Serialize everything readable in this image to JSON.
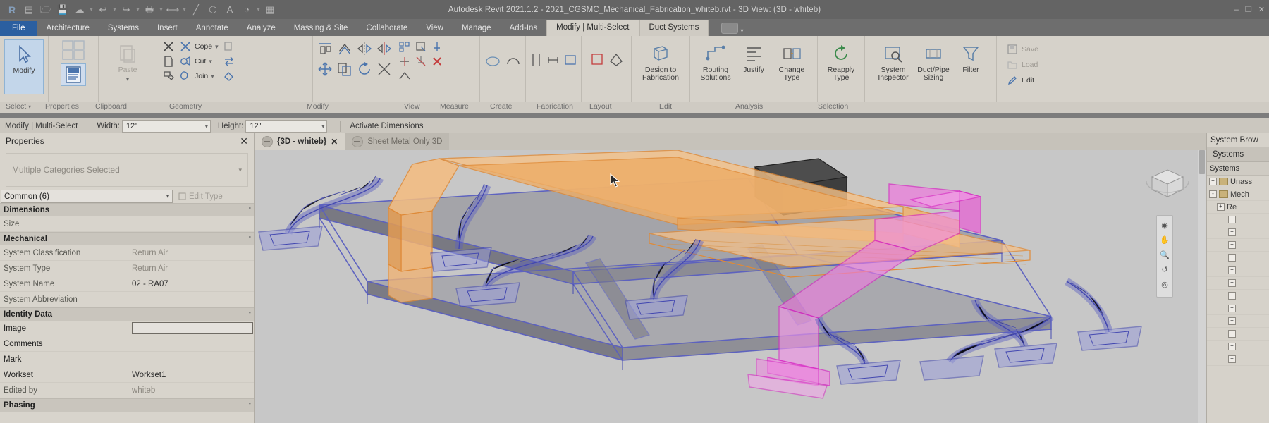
{
  "window": {
    "title": "Autodesk Revit 2021.1.2 - 2021_CGSMC_Mechanical_Fabrication_whiteb.rvt - 3D View: (3D - whiteb)",
    "minimize": "–",
    "maximize": "❐",
    "close": "✕"
  },
  "quick_access": [
    {
      "name": "revit-logo-icon",
      "glyph": "R"
    },
    {
      "name": "new-project-icon",
      "glyph": "▤"
    },
    {
      "name": "open-file-icon",
      "glyph": "🗁"
    },
    {
      "name": "save-icon",
      "glyph": "💾"
    },
    {
      "name": "sync-with-central-icon",
      "glyph": "☁"
    },
    {
      "name": "undo-icon",
      "glyph": "↩"
    },
    {
      "name": "redo-icon",
      "glyph": "↪"
    },
    {
      "name": "print-icon",
      "glyph": "🖨"
    },
    {
      "name": "measure-icon",
      "glyph": "⟷"
    },
    {
      "name": "aligned-dimension-icon",
      "glyph": "╱"
    },
    {
      "name": "tag-icon",
      "glyph": "⬡"
    },
    {
      "name": "text-icon",
      "glyph": "A"
    },
    {
      "name": "section-icon",
      "glyph": "◔"
    },
    {
      "name": "thin-lines-icon",
      "glyph": "▦"
    }
  ],
  "ribbon_tabs": [
    {
      "label": "File",
      "state": "file"
    },
    {
      "label": "Architecture",
      "state": "normal"
    },
    {
      "label": "Systems",
      "state": "normal"
    },
    {
      "label": "Insert",
      "state": "normal"
    },
    {
      "label": "Annotate",
      "state": "normal"
    },
    {
      "label": "Analyze",
      "state": "normal"
    },
    {
      "label": "Massing & Site",
      "state": "normal"
    },
    {
      "label": "Collaborate",
      "state": "normal"
    },
    {
      "label": "View",
      "state": "normal"
    },
    {
      "label": "Manage",
      "state": "normal"
    },
    {
      "label": "Add-Ins",
      "state": "normal"
    },
    {
      "label": "Modify | Multi-Select",
      "state": "active"
    },
    {
      "label": "Duct Systems",
      "state": "context"
    }
  ],
  "ribbon": {
    "select": {
      "panel_label": "Select",
      "modify_label": "Modify"
    },
    "properties": {
      "panel_label": "Properties",
      "properties_label": "Properties"
    },
    "clipboard": {
      "panel_label": "Clipboard",
      "paste_label": "Paste"
    },
    "geometry": {
      "panel_label": "Geometry",
      "cope_label": "Cope",
      "cut_label": "Cut",
      "join_label": "Join"
    },
    "modify": {
      "panel_label": "Modify"
    },
    "view": {
      "panel_label": "View"
    },
    "measure": {
      "panel_label": "Measure"
    },
    "create": {
      "panel_label": "Create"
    },
    "fabrication": {
      "panel_label": "Fabrication",
      "design_to_fabrication": "Design to\nFabrication"
    },
    "layout": {
      "panel_label": "Layout",
      "routing_solutions": "Routing\nSolutions",
      "justify": "Justify",
      "change_type": "Change\nType"
    },
    "edit": {
      "panel_label": "Edit",
      "reapply_type": "Reapply\nType"
    },
    "analysis": {
      "panel_label": "Analysis",
      "system_inspector": "System\nInspector",
      "duct_pipe_sizing": "Duct/Pipe\nSizing",
      "filter": "Filter"
    },
    "selection": {
      "panel_label": "Selection",
      "save": "Save",
      "load": "Load",
      "edit": "Edit"
    }
  },
  "options_bar": {
    "context": "Modify | Multi-Select",
    "width_label": "Width:",
    "width_value": "12\"",
    "height_label": "Height:",
    "height_value": "12\"",
    "activate_dimensions": "Activate Dimensions"
  },
  "properties_palette": {
    "title": "Properties",
    "close": "✕",
    "type_selector": "Multiple Categories Selected",
    "instance_filter": "Common (6)",
    "edit_type": "Edit Type",
    "groups": [
      {
        "name": "Dimensions",
        "rows": [
          {
            "name": "Size",
            "value": "",
            "muted": true
          }
        ]
      },
      {
        "name": "Mechanical",
        "rows": [
          {
            "name": "System Classification",
            "value": "Return Air",
            "muted": true
          },
          {
            "name": "System Type",
            "value": "Return Air",
            "muted": true
          },
          {
            "name": "System Name",
            "value": "02 - RA07",
            "muted": false
          },
          {
            "name": "System Abbreviation",
            "value": "",
            "muted": true
          }
        ]
      },
      {
        "name": "Identity Data",
        "rows": [
          {
            "name": "Image",
            "value": "",
            "muted": false,
            "kind": "imagebox"
          },
          {
            "name": "Comments",
            "value": "",
            "muted": false
          },
          {
            "name": "Mark",
            "value": "",
            "muted": false
          },
          {
            "name": "Workset",
            "value": "Workset1",
            "muted": false
          },
          {
            "name": "Edited by",
            "value": "whiteb",
            "muted": true
          }
        ]
      },
      {
        "name": "Phasing",
        "rows": []
      }
    ]
  },
  "view_tabs": [
    {
      "label": "{3D - whiteb}",
      "active": true,
      "close": "✕"
    },
    {
      "label": "Sheet Metal Only 3D",
      "active": false
    }
  ],
  "system_browser": {
    "title": "System Brow",
    "tab": "Systems",
    "column_header": "Systems",
    "rows": [
      {
        "label": "Unass",
        "expander": "+",
        "indent": 0
      },
      {
        "label": "Mech",
        "expander": "-",
        "indent": 0
      },
      {
        "label": "Re",
        "expander": "+",
        "indent": 1
      },
      {
        "label": "",
        "expander": "+",
        "indent": 2
      },
      {
        "label": "",
        "expander": "+",
        "indent": 2
      },
      {
        "label": "",
        "expander": "+",
        "indent": 2
      },
      {
        "label": "",
        "expander": "+",
        "indent": 2
      },
      {
        "label": "",
        "expander": "+",
        "indent": 2
      },
      {
        "label": "",
        "expander": "+",
        "indent": 2
      },
      {
        "label": "",
        "expander": "+",
        "indent": 2
      },
      {
        "label": "",
        "expander": "+",
        "indent": 2
      },
      {
        "label": "",
        "expander": "+",
        "indent": 2
      },
      {
        "label": "",
        "expander": "+",
        "indent": 2
      },
      {
        "label": "",
        "expander": "+",
        "indent": 2
      },
      {
        "label": "",
        "expander": "+",
        "indent": 2
      }
    ]
  },
  "colors": {
    "canvas_bg": "#c7c7c7",
    "selected_duct_orange": "#f0a95c",
    "selected_duct_magenta": "#e43fd0",
    "duct_blue": "#6a6fc4",
    "duct_gray": "#6e6e78",
    "equipment_dark": "#3c3c3c",
    "ribbon_bg": "#d6d2ca",
    "title_bg": "#646464",
    "file_tab_blue": "#2b5fa0"
  },
  "model": {
    "description": "3D isometric view of mechanical duct network with return air branches, orange and magenta highlighted selected ducts, blue diffuser drops and a dark gray air handling unit"
  }
}
